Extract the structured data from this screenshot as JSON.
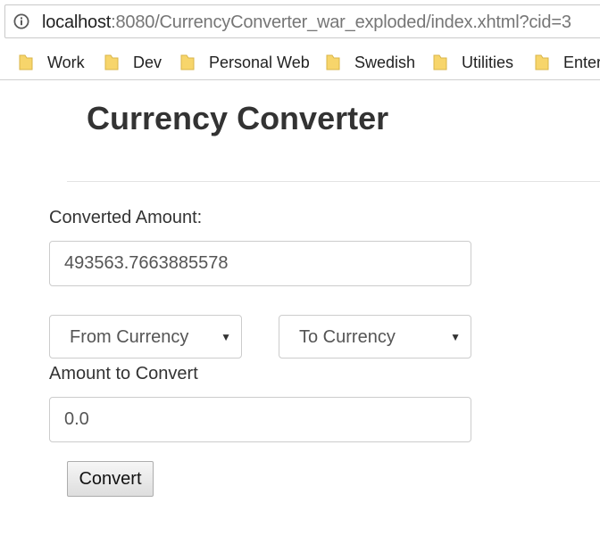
{
  "browser": {
    "url_host": "localhost",
    "url_rest": ":8080/CurrencyConverter_war_exploded/index.xhtml?cid=3",
    "bookmarks": [
      {
        "label": "Work"
      },
      {
        "label": "Dev"
      },
      {
        "label": "Personal Web"
      },
      {
        "label": "Swedish"
      },
      {
        "label": "Utilities"
      },
      {
        "label": "Enter"
      }
    ]
  },
  "page": {
    "title": "Currency Converter",
    "converted_label": "Converted Amount:",
    "converted_value": "493563.7663885578",
    "from_currency": "From Currency",
    "to_currency": "To Currency",
    "amount_label": "Amount to Convert",
    "amount_value": "0.0",
    "convert_button": "Convert"
  },
  "colors": {
    "text": "#333333",
    "input_border": "#cccccc",
    "folder_icon": "#f7d56b"
  }
}
